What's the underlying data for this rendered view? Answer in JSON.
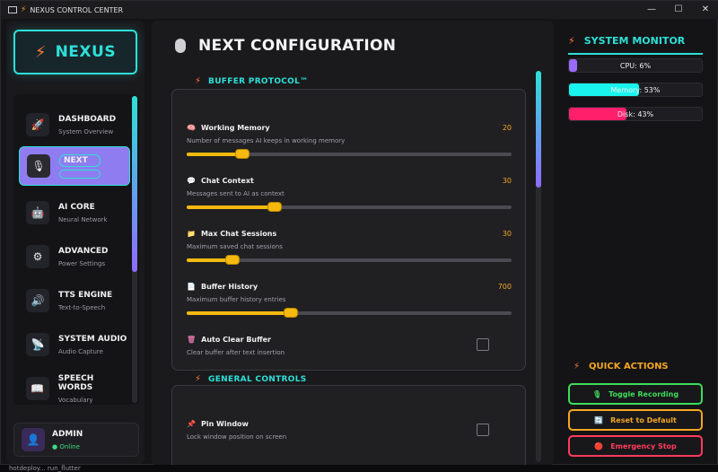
{
  "window": {
    "title": "NEXUS CONTROL CENTER",
    "controls": [
      "—",
      "☐",
      "✕"
    ]
  },
  "logo": {
    "text": "NEXUS"
  },
  "nav": [
    {
      "title": "DASHBOARD",
      "subtitle": "System Overview",
      "icon": "rocket-icon",
      "glyph": "🚀"
    },
    {
      "title": "NEXT",
      "subtitle": "",
      "icon": "microphone-icon",
      "glyph": "🎙"
    },
    {
      "title": "AI CORE",
      "subtitle": "Neural Network",
      "icon": "robot-icon",
      "glyph": "🤖"
    },
    {
      "title": "ADVANCED",
      "subtitle": "Power Settings",
      "icon": "gear-icon",
      "glyph": "⚙"
    },
    {
      "title": "TTS ENGINE",
      "subtitle": "Text-to-Speech",
      "icon": "speaker-icon",
      "glyph": "🔊"
    },
    {
      "title": "SYSTEM AUDIO",
      "subtitle": "Audio Capture",
      "icon": "satellite-icon",
      "glyph": "📡"
    },
    {
      "title": "SPEECH WORDS",
      "subtitle": "Vocabulary",
      "icon": "book-icon",
      "glyph": "📖"
    }
  ],
  "user": {
    "name": "ADMIN",
    "status": "● Online"
  },
  "main": {
    "title": "NEXT CONFIGURATION",
    "buffer_section": "BUFFER PROTOCOL™",
    "general_section": "GENERAL CONTROLS",
    "settings": [
      {
        "name": "Working Memory",
        "desc": "Number of messages AI keeps in working memory",
        "value": "20",
        "fraction": 0.17,
        "icon": "brain-icon",
        "glyph": "🧠"
      },
      {
        "name": "Chat Context",
        "desc": "Messages sent to AI as context",
        "value": "30",
        "fraction": 0.27,
        "icon": "speech-bubble-icon",
        "glyph": "💬"
      },
      {
        "name": "Max Chat Sessions",
        "desc": "Maximum saved chat sessions",
        "value": "30",
        "fraction": 0.14,
        "icon": "folder-icon",
        "glyph": "📁"
      },
      {
        "name": "Buffer History",
        "desc": "Maximum buffer history entries",
        "value": "700",
        "fraction": 0.32,
        "icon": "document-icon",
        "glyph": "📄"
      }
    ],
    "auto_clear": {
      "name": "Auto Clear Buffer",
      "desc": "Clear buffer after text insertion",
      "glyph": "🗑"
    },
    "pin_window": {
      "name": "Pin Window",
      "desc": "Lock window position on screen",
      "glyph": "📌"
    }
  },
  "monitor": {
    "title": "SYSTEM MONITOR",
    "meters": [
      {
        "label": "CPU: 6%",
        "value": 0.06,
        "color": "#9a6bff"
      },
      {
        "label": "Memory: 53%",
        "value": 0.53,
        "color": "#19f5ee"
      },
      {
        "label": "Disk: 43%",
        "value": 0.43,
        "color": "#ff1f6b"
      }
    ]
  },
  "actions": {
    "title": "QUICK ACTIONS",
    "buttons": [
      {
        "label": "Toggle Recording",
        "color": "#3ddc5a",
        "icon": "microphone-icon",
        "glyph": "🎙"
      },
      {
        "label": "Reset to Default",
        "color": "#f5a623",
        "icon": "refresh-icon",
        "glyph": "🔄"
      },
      {
        "label": "Emergency Stop",
        "color": "#ff3b5c",
        "icon": "stop-icon",
        "glyph": "🔴"
      }
    ]
  },
  "taskbar": {
    "text": "hotdeploy... run_flutter"
  }
}
